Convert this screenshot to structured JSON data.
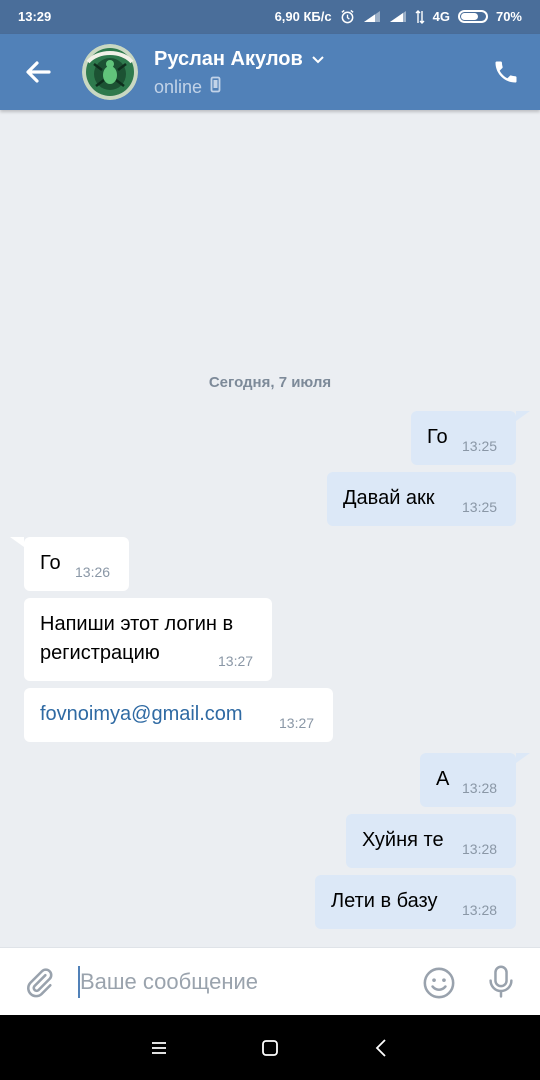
{
  "status_bar": {
    "time": "13:29",
    "speed": "6,90 КБ/с",
    "network": "4G",
    "battery": "70%",
    "battery_level": 0.7
  },
  "header": {
    "contact_name": "Руслан Акулов",
    "status": "online",
    "back_icon": "arrow-left-icon",
    "call_icon": "phone-icon",
    "accent": "#5181b8"
  },
  "chat": {
    "date_separator": "Сегодня, 7 июля",
    "messages": [
      {
        "dir": "out",
        "text": "Го",
        "time": "13:25"
      },
      {
        "dir": "out",
        "text": "Давай акк",
        "time": "13:25"
      },
      {
        "dir": "in",
        "text": "Го",
        "time": "13:26"
      },
      {
        "dir": "in",
        "text_line1": "Напиши этот логин в",
        "text_line2": "регистрацию",
        "time": "13:27"
      },
      {
        "dir": "in",
        "text": "fovnoimya@gmail.com",
        "time": "13:27",
        "is_link": true
      },
      {
        "dir": "out",
        "text": "А",
        "time": "13:28"
      },
      {
        "dir": "out",
        "text": "Хуйня те",
        "time": "13:28"
      },
      {
        "dir": "out",
        "text": "Лети в базу",
        "time": "13:28"
      }
    ]
  },
  "composer": {
    "placeholder": "Ваше сообщение",
    "value": "",
    "attach_icon": "paperclip-icon",
    "emoji_icon": "smiley-icon",
    "mic_icon": "microphone-icon"
  },
  "nav": {
    "menu_icon": "menu-icon",
    "home_icon": "home-square-icon",
    "back_icon": "back-triangle-icon"
  }
}
